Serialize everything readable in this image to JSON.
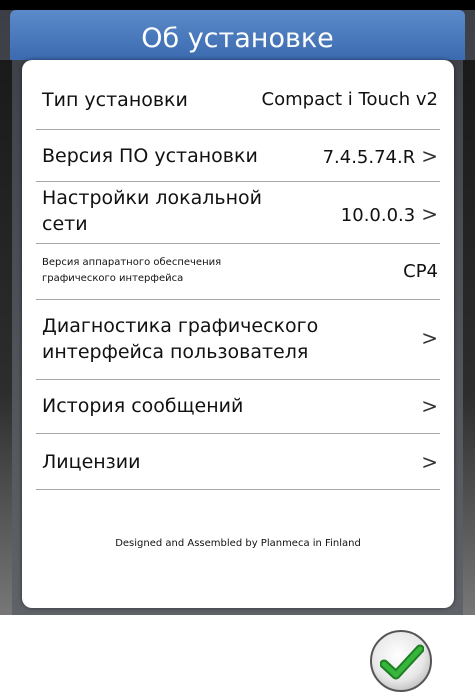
{
  "header": {
    "top_partial_text": "",
    "title": "Об установке"
  },
  "rows": [
    {
      "label": "Тип установки",
      "value": "Compact i Touch v2",
      "chevron": ""
    },
    {
      "label": "Версия ПО установки",
      "value": "7.4.5.74.R",
      "chevron": ">"
    },
    {
      "label_line1": "Настройки локальной",
      "label_line2": "сети",
      "value": "10.0.0.3",
      "chevron": ">"
    },
    {
      "label_line1": "Версия аппаратного обеспечения",
      "label_line2": "графического интерфейса",
      "value": "CP4",
      "chevron": ""
    },
    {
      "label_line1": "Диагностика графического",
      "label_line2": "интерфейса пользователя",
      "value": "",
      "chevron": ">"
    },
    {
      "label": "История сообщений",
      "value": "",
      "chevron": ">"
    },
    {
      "label": "Лицензии",
      "value": "",
      "chevron": ">"
    }
  ],
  "footer": {
    "text": "Designed and Assembled by Planmeca in Finland"
  },
  "ok_button": {
    "icon": "checkmark-icon",
    "accent": "#2a9a2f"
  }
}
